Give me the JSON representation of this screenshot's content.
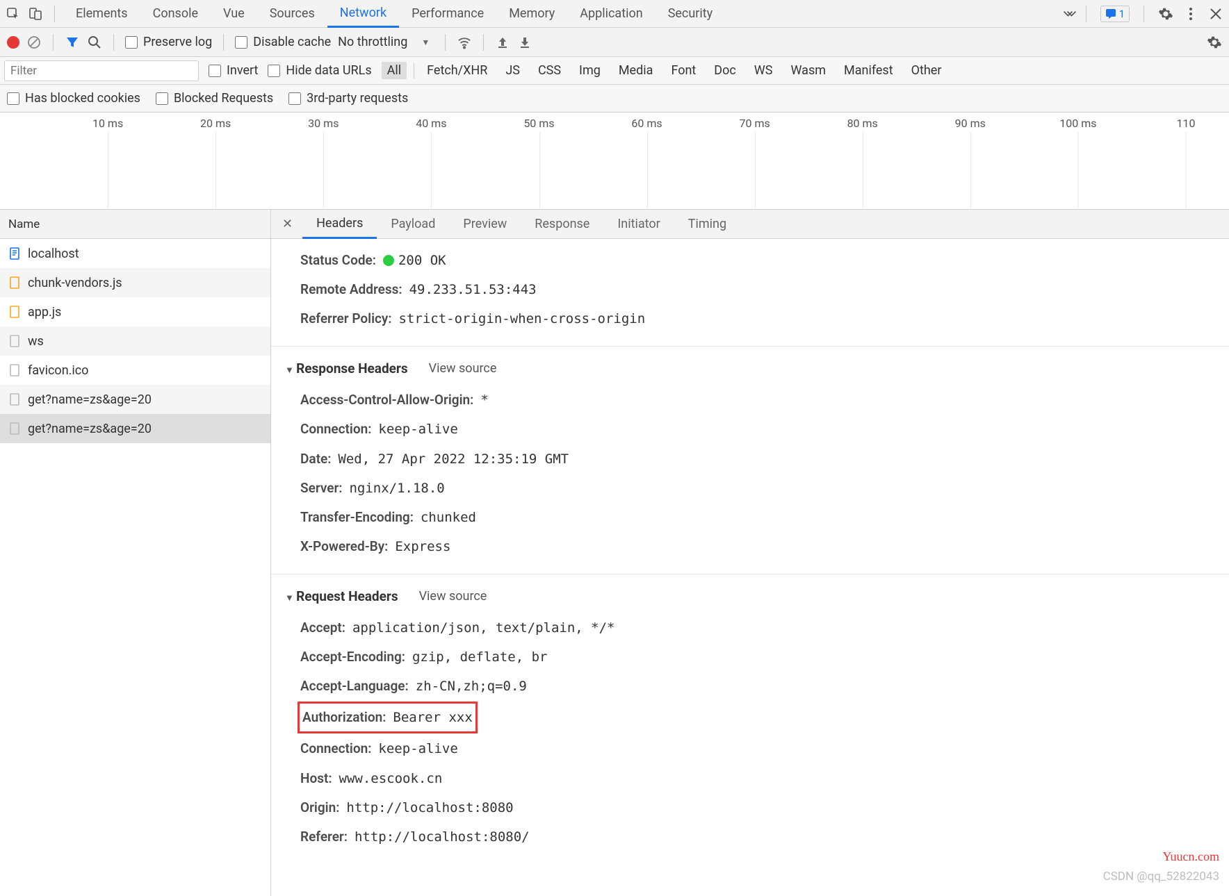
{
  "topTabs": [
    "Elements",
    "Console",
    "Vue",
    "Sources",
    "Network",
    "Performance",
    "Memory",
    "Application",
    "Security"
  ],
  "activeTopTab": 4,
  "badgeCount": "1",
  "toolbar": {
    "preserveLog": "Preserve log",
    "disableCache": "Disable cache",
    "throttling": "No throttling"
  },
  "filter": {
    "placeholder": "Filter",
    "invert": "Invert",
    "hideUrls": "Hide data URLs",
    "types": [
      "All",
      "Fetch/XHR",
      "JS",
      "CSS",
      "Img",
      "Media",
      "Font",
      "Doc",
      "WS",
      "Wasm",
      "Manifest",
      "Other"
    ],
    "activeType": 0
  },
  "filter2": {
    "hasBlocked": "Has blocked cookies",
    "blockedReq": "Blocked Requests",
    "thirdParty": "3rd-party requests"
  },
  "timelineTicks": [
    "10 ms",
    "20 ms",
    "30 ms",
    "40 ms",
    "50 ms",
    "60 ms",
    "70 ms",
    "80 ms",
    "90 ms",
    "100 ms",
    "110"
  ],
  "nameHeader": "Name",
  "requests": [
    {
      "name": "localhost",
      "icon": "doc"
    },
    {
      "name": "chunk-vendors.js",
      "icon": "js"
    },
    {
      "name": "app.js",
      "icon": "js"
    },
    {
      "name": "ws",
      "icon": "blank"
    },
    {
      "name": "favicon.ico",
      "icon": "blank"
    },
    {
      "name": "get?name=zs&age=20",
      "icon": "blank"
    },
    {
      "name": "get?name=zs&age=20",
      "icon": "blank"
    }
  ],
  "selectedRequest": 6,
  "detailTabs": [
    "Headers",
    "Payload",
    "Preview",
    "Response",
    "Initiator",
    "Timing"
  ],
  "activeDetailTab": 0,
  "general": {
    "status": {
      "k": "Status Code:",
      "v": "200 OK"
    },
    "remote": {
      "k": "Remote Address:",
      "v": "49.233.51.53:443"
    },
    "refpol": {
      "k": "Referrer Policy:",
      "v": "strict-origin-when-cross-origin"
    }
  },
  "responseHeaders": {
    "title": "Response Headers",
    "src": "View source",
    "items": [
      {
        "k": "Access-Control-Allow-Origin:",
        "v": "*"
      },
      {
        "k": "Connection:",
        "v": "keep-alive"
      },
      {
        "k": "Date:",
        "v": "Wed, 27 Apr 2022 12:35:19 GMT"
      },
      {
        "k": "Server:",
        "v": "nginx/1.18.0"
      },
      {
        "k": "Transfer-Encoding:",
        "v": "chunked"
      },
      {
        "k": "X-Powered-By:",
        "v": "Express"
      }
    ]
  },
  "requestHeaders": {
    "title": "Request Headers",
    "src": "View source",
    "items": [
      {
        "k": "Accept:",
        "v": "application/json, text/plain, */*"
      },
      {
        "k": "Accept-Encoding:",
        "v": "gzip, deflate, br"
      },
      {
        "k": "Accept-Language:",
        "v": "zh-CN,zh;q=0.9"
      },
      {
        "k": "Authorization:",
        "v": "Bearer xxx",
        "hl": true
      },
      {
        "k": "Connection:",
        "v": "keep-alive"
      },
      {
        "k": "Host:",
        "v": "www.escook.cn"
      },
      {
        "k": "Origin:",
        "v": "http://localhost:8080"
      },
      {
        "k": "Referer:",
        "v": "http://localhost:8080/"
      }
    ]
  },
  "watermark1": "Yuucn.com",
  "watermark2": "CSDN @qq_52822043"
}
